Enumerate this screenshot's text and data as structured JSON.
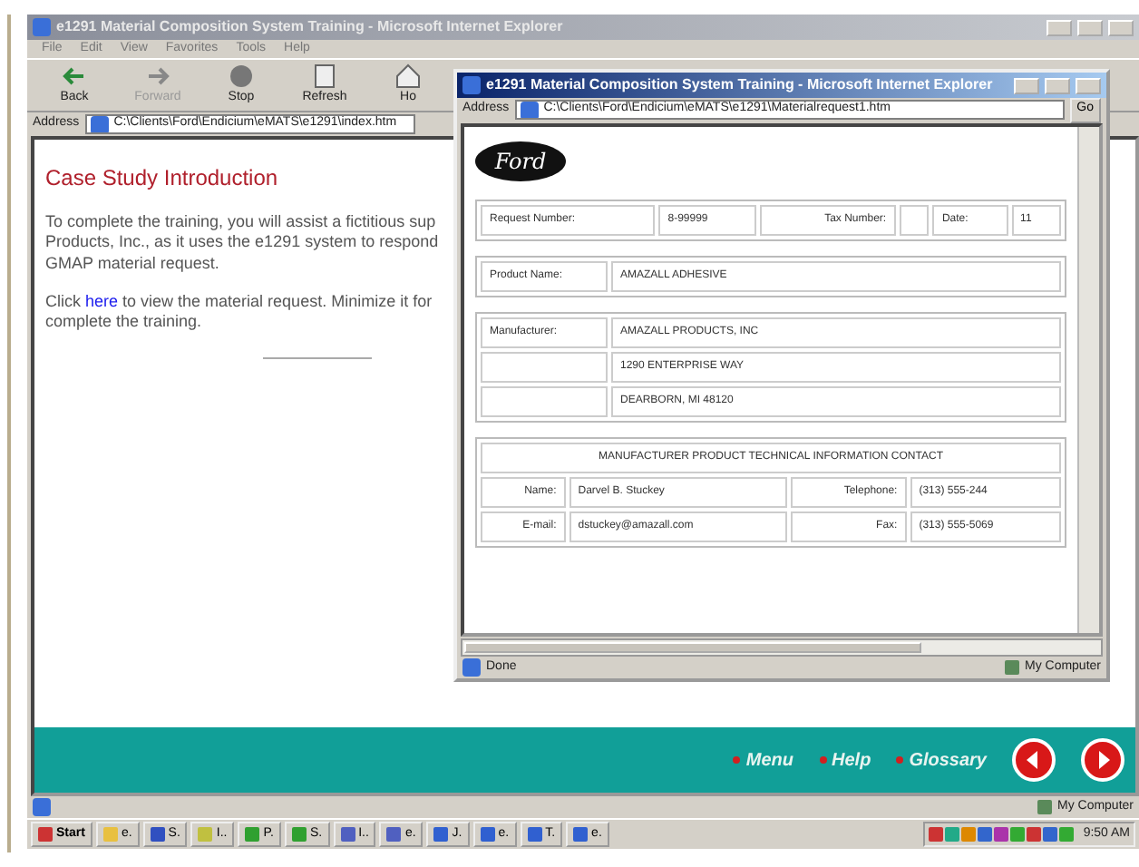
{
  "back_window": {
    "title": "e1291 Material Composition System Training - Microsoft Internet Explorer",
    "active": false,
    "menu": [
      {
        "label": "File"
      },
      {
        "label": "Edit"
      },
      {
        "label": "View"
      },
      {
        "label": "Favorites"
      },
      {
        "label": "Tools"
      },
      {
        "label": "Help"
      }
    ],
    "toolbar": [
      {
        "label": "Back",
        "kind": "back",
        "disabled": false
      },
      {
        "label": "Forward",
        "kind": "forward",
        "disabled": true
      },
      {
        "label": "Stop",
        "kind": "stop",
        "disabled": false
      },
      {
        "label": "Refresh",
        "kind": "refresh",
        "disabled": false
      },
      {
        "label": "Ho",
        "kind": "home",
        "disabled": false
      }
    ],
    "address_label": "Address",
    "address": "C:\\Clients\\Ford\\Endicium\\eMATS\\e1291\\index.htm",
    "heading": "Case Study Introduction",
    "paragraph": "To complete the training, you will assist a fictitious sup Products, Inc., as it uses the e1291 system to respond GMAP material request.",
    "click": {
      "before": "Click ",
      "link": "here",
      "after": " to view the material request. Minimize it for complete the training."
    },
    "nav": [
      {
        "label": "Menu"
      },
      {
        "label": "Help"
      },
      {
        "label": "Glossary"
      }
    ],
    "status": "My Computer"
  },
  "front_window": {
    "title": "e1291 Material Composition System Training - Microsoft Internet Explorer",
    "active": true,
    "address_label": "Address",
    "address": "C:\\Clients\\Ford\\Endicium\\eMATS\\e1291\\Materialrequest1.htm",
    "go": "Go",
    "logo": "Ford",
    "request": {
      "label": "Request Number:",
      "value": "8-99999",
      "tax_label": "Tax Number:",
      "date_label": "Date:",
      "date": "11"
    },
    "product": {
      "label": "Product Name:",
      "value": "AMAZALL ADHESIVE"
    },
    "manufacturer": {
      "label": "Manufacturer:",
      "lines": [
        "AMAZALL PRODUCTS, INC",
        "1290 ENTERPRISE WAY",
        "DEARBORN, MI 48120"
      ]
    },
    "contact": {
      "heading": "MANUFACTURER PRODUCT TECHNICAL INFORMATION CONTACT",
      "rows": [
        {
          "label": "Name:",
          "value": "Darvel B. Stuckey",
          "label2": "Telephone:",
          "value2": "(313) 555-244"
        },
        {
          "label": "E-mail:",
          "value": "dstuckey@amazall.com",
          "label2": "Fax:",
          "value2": "(313) 555-5069"
        }
      ]
    },
    "status": "Done",
    "zone": "My Computer"
  },
  "taskbar": {
    "start": "Start",
    "items": [
      {
        "label": "e."
      },
      {
        "label": "S."
      },
      {
        "label": "I.."
      },
      {
        "label": "P."
      },
      {
        "label": "S."
      },
      {
        "label": "I.."
      },
      {
        "label": "e."
      },
      {
        "label": "J."
      },
      {
        "label": "e."
      },
      {
        "label": "T."
      },
      {
        "label": "e."
      }
    ],
    "time": "9:50 AM"
  }
}
